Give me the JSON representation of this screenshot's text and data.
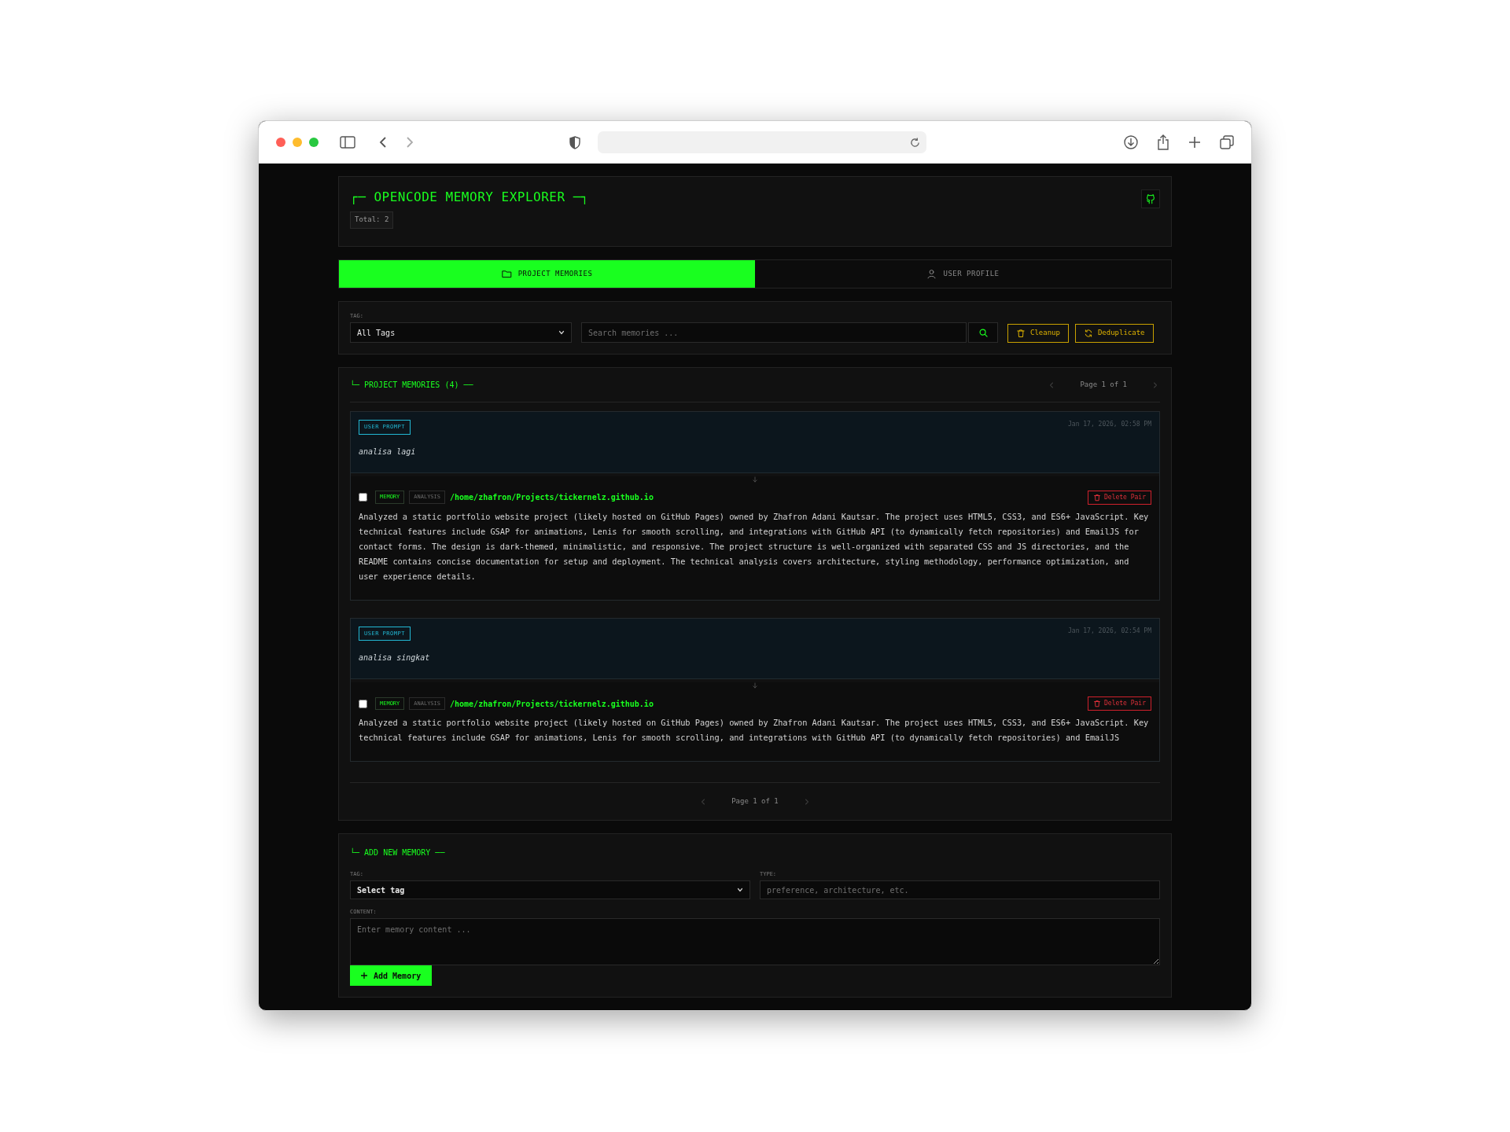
{
  "header": {
    "title": "┌─ OPENCODE MEMORY EXPLORER ─┐",
    "total": "Total: 2"
  },
  "tabs": [
    {
      "label": "PROJECT MEMORIES",
      "selected": true
    },
    {
      "label": "USER PROFILE",
      "selected": false
    }
  ],
  "filters": {
    "tag_label": "TAG:",
    "tag_value": "All Tags",
    "search_placeholder": "Search memories ...",
    "buttons": [
      {
        "label": "Cleanup"
      },
      {
        "label": "Deduplicate"
      }
    ]
  },
  "memories": {
    "title": "└─ PROJECT MEMORIES (4) ──",
    "pagination_top": "Page 1 of 1",
    "pairs": [
      {
        "prompt_tag": "USER PROMPT",
        "timestamp": "Jan 17, 2026, 02:58 PM",
        "prompt": "analisa lagi",
        "checked": false,
        "tags": [
          {
            "label": "MEMORY",
            "kind": "primary"
          },
          {
            "label": "ANALYSIS",
            "kind": "muted"
          }
        ],
        "path": "/home/zhafron/Projects/tickernelz.github.io",
        "delete_label": "Delete Pair",
        "content": "Analyzed a static portfolio website project (likely hosted on GitHub Pages) owned by Zhafron Adani Kautsar. The project uses HTML5, CSS3, and ES6+ JavaScript. Key technical features include GSAP for animations, Lenis for smooth scrolling, and integrations with GitHub API (to dynamically fetch repositories) and EmailJS for contact forms. The design is dark-themed, minimalistic, and responsive. The project structure is well-organized with separated CSS and JS directories, and the README contains concise documentation for setup and deployment. The technical analysis covers architecture, styling methodology, performance optimization, and user experience details."
      },
      {
        "prompt_tag": "USER PROMPT",
        "timestamp": "Jan 17, 2026, 02:54 PM",
        "prompt": "analisa singkat",
        "checked": false,
        "tags": [
          {
            "label": "MEMORY",
            "kind": "primary"
          },
          {
            "label": "ANALYSIS",
            "kind": "muted"
          }
        ],
        "path": "/home/zhafron/Projects/tickernelz.github.io",
        "delete_label": "Delete Pair",
        "content": "Analyzed a static portfolio website project (likely hosted on GitHub Pages) owned by Zhafron Adani Kautsar. The project uses HTML5, CSS3, and ES6+ JavaScript. Key technical features include GSAP for animations, Lenis for smooth scrolling, and integrations with GitHub API (to dynamically fetch repositories) and EmailJS"
      }
    ],
    "pagination_bottom": "Page 1 of 1"
  },
  "add": {
    "title": "└─ ADD NEW MEMORY ──",
    "tag_label": "TAG:",
    "tag_value": "Select tag",
    "type_label": "TYPE:",
    "type_placeholder": "preference, architecture, etc.",
    "content_label": "CONTENT:",
    "content_placeholder": "Enter memory content ...",
    "button": "Add Memory"
  }
}
